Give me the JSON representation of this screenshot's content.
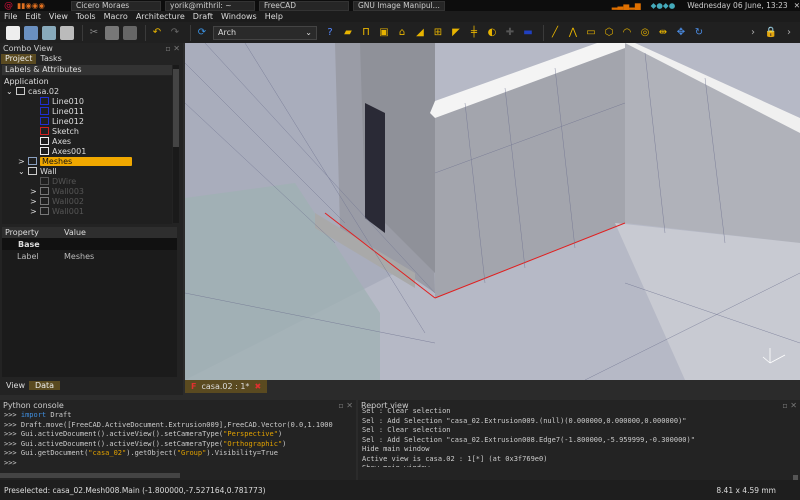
{
  "taskbar": {
    "tasks": [
      "Cícero Moraes",
      "yorik@mithril: ~",
      "FreeCAD",
      "GNU Image Manipul..."
    ],
    "clock": "Wednesday 06 June, 13:23"
  },
  "menu": [
    "File",
    "Edit",
    "View",
    "Tools",
    "Macro",
    "Architecture",
    "Draft",
    "Windows",
    "Help"
  ],
  "toolbar": {
    "workbench": "Arch"
  },
  "combo": {
    "title": "Combo View",
    "tabs": [
      "Project",
      "Tasks"
    ],
    "tree_header": "Labels & Attributes",
    "application": "Application",
    "items": [
      {
        "label": "casa.02",
        "indent": 0,
        "arrow": "v",
        "icon": "document-icon",
        "color": "#cccccc"
      },
      {
        "label": "Line010",
        "indent": 2,
        "icon": "wire-icon",
        "color": "#2030d0"
      },
      {
        "label": "Line011",
        "indent": 2,
        "icon": "wire-icon",
        "color": "#2030d0"
      },
      {
        "label": "Line012",
        "indent": 2,
        "icon": "wire-icon",
        "color": "#2030d0"
      },
      {
        "label": "Sketch",
        "indent": 2,
        "icon": "sketch-icon",
        "color": "#d02020"
      },
      {
        "label": "Axes",
        "indent": 2,
        "icon": "axes-icon",
        "color": "#eeeeee"
      },
      {
        "label": "Axes001",
        "indent": 2,
        "icon": "axes-icon",
        "color": "#eeeeee"
      },
      {
        "label": "Meshes",
        "indent": 1,
        "arrow": ">",
        "icon": "folder-icon",
        "color": "#8aa0c0",
        "selected": true
      },
      {
        "label": "Wall",
        "indent": 1,
        "arrow": "v",
        "icon": "wall-icon",
        "color": "#cccccc"
      },
      {
        "label": "DWire",
        "indent": 2,
        "icon": "wire-icon",
        "color": "#555555",
        "dim": true
      },
      {
        "label": "Wall003",
        "indent": 2,
        "arrow": ">",
        "icon": "wall-icon",
        "color": "#777777",
        "dim": true
      },
      {
        "label": "Wall002",
        "indent": 2,
        "arrow": ">",
        "icon": "wall-icon",
        "color": "#777777",
        "dim": true
      },
      {
        "label": "Wall001",
        "indent": 2,
        "arrow": ">",
        "icon": "wall-icon",
        "color": "#777777",
        "dim": true
      }
    ],
    "property_header": [
      "Property",
      "Value"
    ],
    "group": "Base",
    "property": {
      "name": "Label",
      "value": "Meshes"
    },
    "bottom_tabs": [
      "View",
      "Data"
    ]
  },
  "doc_tab": "casa.02 : 1*",
  "python": {
    "title": "Python console",
    "lines": [
      [
        [
          "p",
          ">>> "
        ],
        [
          "k",
          "import"
        ],
        [
          "p",
          " Draft"
        ]
      ],
      [
        [
          "p",
          ">>> Draft.move([FreeCAD.ActiveDocument.Extrusion009],FreeCAD.Vector(0.0,1.1000"
        ]
      ],
      [
        [
          "p",
          ">>> Gui.activeDocument().activeView().setCameraType("
        ],
        [
          "s",
          "\"Perspective\""
        ],
        [
          "p",
          ")"
        ]
      ],
      [
        [
          "p",
          ">>> Gui.activeDocument().activeView().setCameraType("
        ],
        [
          "s",
          "\"Orthographic\""
        ],
        [
          "p",
          ")"
        ]
      ],
      [
        [
          "p",
          ">>> Gui.getDocument("
        ],
        [
          "s",
          "\"casa_02\""
        ],
        [
          "p",
          ").getObject("
        ],
        [
          "s",
          "\"Group\""
        ],
        [
          "p",
          ").Visibility=True"
        ]
      ],
      [
        [
          "p",
          ">>> "
        ]
      ]
    ]
  },
  "report": {
    "title": "Report view",
    "lines": [
      "Sel : Clear selection",
      "Sel : Add Selection \"casa_02.Extrusion009.(null)(0.000000,0.000000,0.000000)\"",
      "Sel : Clear selection",
      "Sel : Add Selection \"casa_02.Extrusion008.Edge7(-1.800000,-5.959999,-0.300000)\"",
      "Hide main window",
      "Active view is casa.02 : 1[*] (at 0x3f769e0)",
      "Show main window"
    ]
  },
  "status": {
    "message": "Preselected: casa_02.Mesh008.Main (-1.800000,-7.527164,0.781773)",
    "dimensions": "8.41 x 4.59 mm"
  },
  "colors": {
    "selection": "#f0a800",
    "tab_active": "#5a4a20",
    "edge_highlight": "#e02020"
  }
}
